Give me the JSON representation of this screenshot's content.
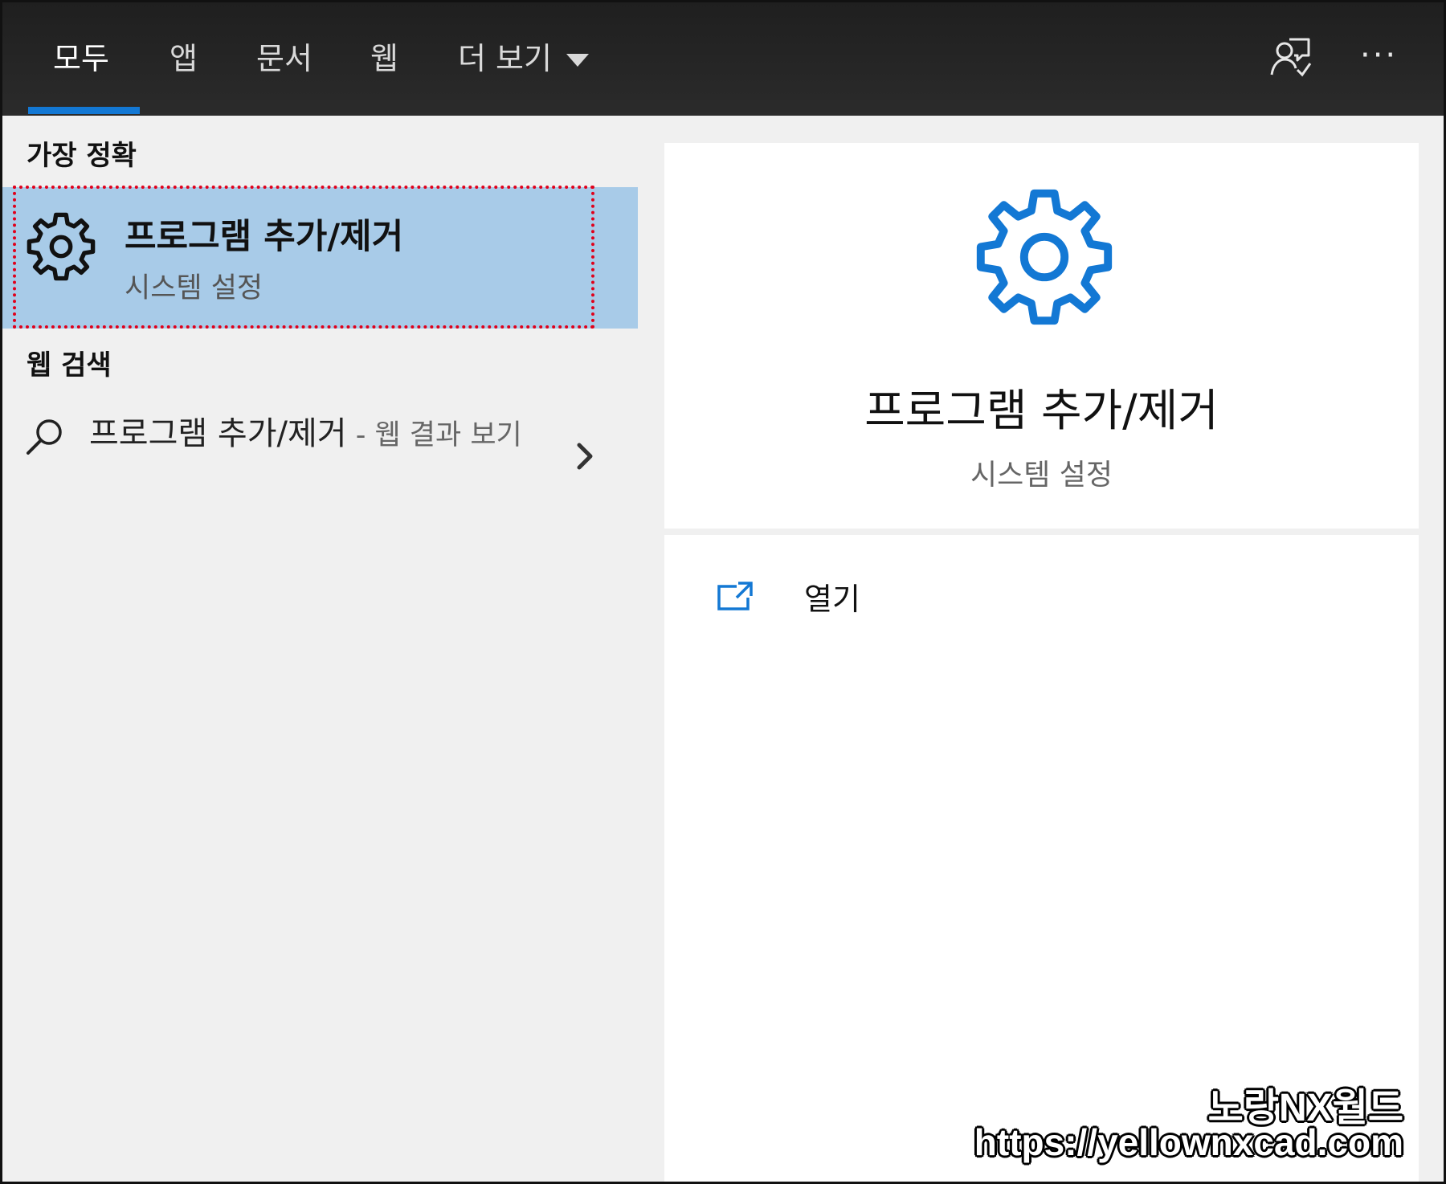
{
  "tabs": [
    {
      "label": "모두",
      "active": true
    },
    {
      "label": "앱"
    },
    {
      "label": "문서"
    },
    {
      "label": "웹"
    },
    {
      "label": "더 보기"
    }
  ],
  "toolbar": {
    "feedback_icon": "feedback-person-icon",
    "more_icon": "ellipsis-icon",
    "more_text": "···"
  },
  "best_match": {
    "section_title": "가장 정확",
    "icon": "gear-icon",
    "name": "프로그램 추가/제거",
    "subtitle": "시스템 설정"
  },
  "web_search": {
    "section_title": "웹 검색",
    "icon": "search-icon",
    "query": "프로그램 추가/제거",
    "suffix": " - 웹 결과 보기"
  },
  "detail": {
    "icon": "gear-icon",
    "name": "프로그램 추가/제거",
    "subtitle": "시스템 설정",
    "actions": [
      {
        "label": "열기",
        "icon": "open-external-icon"
      }
    ]
  },
  "watermark": {
    "name": "노랑NX월드",
    "url": "https://yellownxcad.com"
  },
  "colors": {
    "accent": "#1378d4",
    "topbar": "#262626",
    "selected_bg": "#a8cbe8",
    "highlight_border": "#e0001b",
    "pane_bg": "#f0f0f0"
  }
}
